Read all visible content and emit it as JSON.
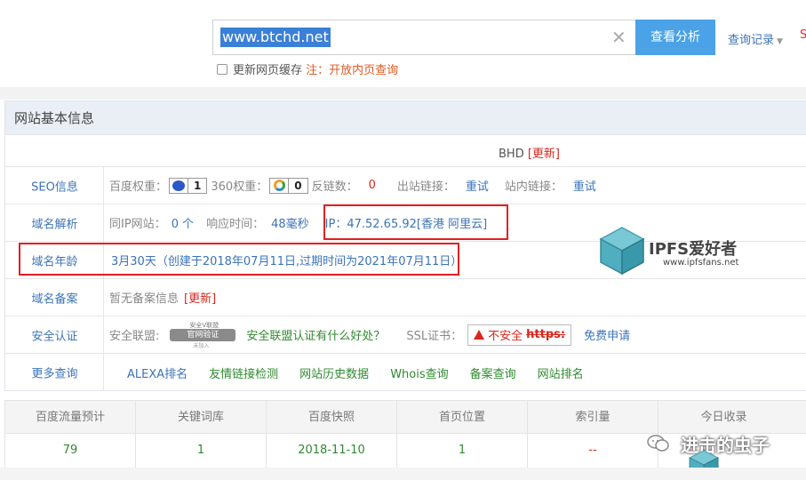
{
  "search": {
    "value": "www.btchd.net/",
    "button": "查看分析",
    "history": "查询记录",
    "edge_char": "S",
    "cache_label": "更新网页缓存",
    "cache_note": "注：开放内页查询"
  },
  "panel": {
    "title": "网站基本信息",
    "site_name": "BHD",
    "site_update": "[更新]"
  },
  "seo": {
    "label": "SEO信息",
    "baidu_label": "百度权重：",
    "baidu_value": "1",
    "s360_label": "360权重：",
    "s360_value": "0",
    "backlinks_label": "反链数：",
    "backlinks_value": "0",
    "outlinks_label": "出站链接：",
    "outlinks_value": "重试",
    "inlinks_label": "站内链接：",
    "inlinks_value": "重试"
  },
  "dns": {
    "label": "域名解析",
    "sameip_label": "同IP网站：",
    "sameip_value": "0 个",
    "response_label": "响应时间：",
    "response_value": "48毫秒",
    "ip": "IP：47.52.65.92[香港 阿里云]"
  },
  "age": {
    "label": "域名年龄",
    "value": "3月30天（创建于2018年07月11日,过期时间为2021年07月11日）"
  },
  "icp": {
    "label": "域名备案",
    "value": "暂无备案信息",
    "update": "[更新]"
  },
  "security": {
    "label": "安全认证",
    "alliance_label": "安全联盟:",
    "seal_top": "安全V联盟",
    "seal_text": "官网验证",
    "seal_bottom": "未加入",
    "alliance_link": "安全联盟认证有什么好处？",
    "ssl_label": "SSL证书：",
    "ssl_status": "不安全",
    "ssl_https": "https:",
    "free_apply": "免费申请"
  },
  "more": {
    "label": "更多查询",
    "links": [
      "ALEXA排名",
      "友情链接检测",
      "网站历史数据",
      "Whois查询",
      "备案查询",
      "网站排名"
    ]
  },
  "watermark": {
    "name": "IPFS爱好者",
    "url": "www.ipfsfans.net",
    "wechat": "进击的虫子"
  },
  "stats": {
    "headers": [
      "百度流量预计",
      "关键词库",
      "百度快照",
      "首页位置",
      "索引量",
      "今日收录"
    ],
    "values": [
      "79",
      "1",
      "2018-11-10",
      "1",
      "--",
      ""
    ]
  },
  "colors": {
    "link_blue": "#3b73b9",
    "green": "#2f8a2f",
    "red": "#d9261c",
    "button": "#4ba2e6"
  }
}
